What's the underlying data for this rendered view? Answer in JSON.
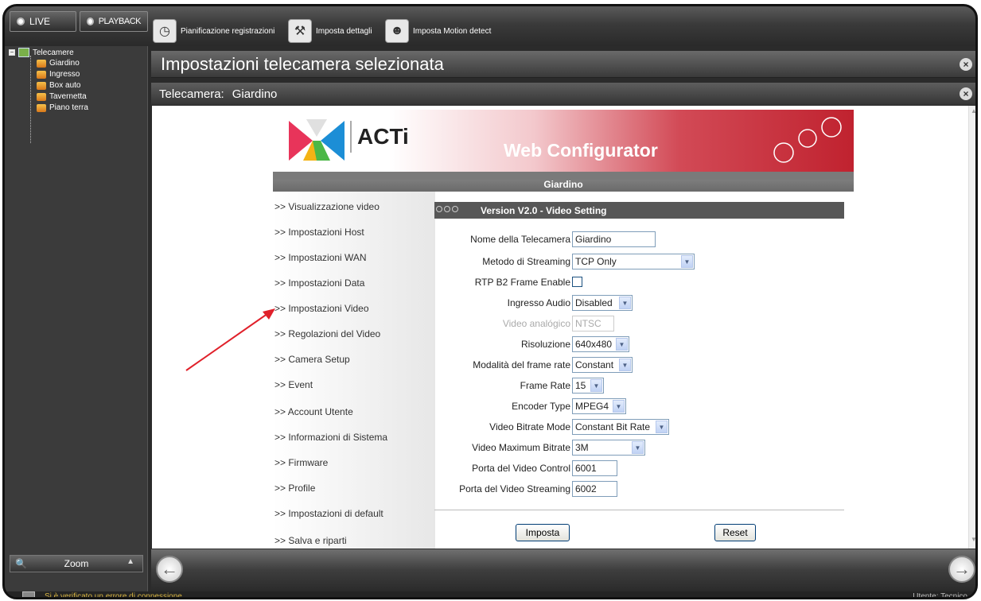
{
  "topbar": {
    "live_label": "LIVE",
    "playback_label": "PLAYBACK",
    "tools": [
      {
        "label": "Pianificazione registrazioni",
        "icon": "clock-icon"
      },
      {
        "label": "Imposta dettagli",
        "icon": "tools-icon"
      },
      {
        "label": "Imposta Motion detect",
        "icon": "motion-icon"
      }
    ]
  },
  "tree": {
    "root": "Telecamere",
    "items": [
      "Giardino",
      "Ingresso",
      "Box auto",
      "Tavernetta",
      "Piano terra"
    ]
  },
  "zoom_label": "Zoom",
  "header": {
    "title": "Impostazioni telecamera selezionata",
    "camera_label": "Telecamera:",
    "camera_name": "Giardino"
  },
  "banner": {
    "logo_text": "ACTi",
    "product": "Web Configurator",
    "camera_strip": "Giardino"
  },
  "menu": [
    ">> Visualizzazione video",
    ">> Impostazioni Host",
    ">> Impostazioni WAN",
    ">> Impostazioni Data",
    ">> Impostazioni Video",
    ">> Regolazioni del Video",
    ">> Camera Setup",
    ">> Event",
    ">> Account Utente",
    ">> Informazioni di Sistema",
    ">> Firmware",
    ">> Profile",
    ">> Impostazioni di default",
    ">> Salva e riparti"
  ],
  "video_setting": {
    "header": "Version V2.0 - Video Setting",
    "fields": {
      "nome": {
        "label": "Nome della Telecamera",
        "value": "Giardino"
      },
      "metodo": {
        "label": "Metodo di Streaming",
        "value": "TCP Only"
      },
      "rtp": {
        "label": "RTP B2 Frame Enable",
        "checked": false
      },
      "audio": {
        "label": "Ingresso Audio",
        "value": "Disabled"
      },
      "analogico": {
        "label": "Video analógico",
        "value": "NTSC"
      },
      "risoluzione": {
        "label": "Risoluzione",
        "value": "640x480"
      },
      "modalita": {
        "label": "Modalità del frame rate",
        "value": "Constant"
      },
      "framerate": {
        "label": "Frame Rate",
        "value": "15"
      },
      "encoder": {
        "label": "Encoder Type",
        "value": "MPEG4"
      },
      "bitrate_mode": {
        "label": "Video Bitrate Mode",
        "value": "Constant Bit Rate"
      },
      "max_bitrate": {
        "label": "Video Maximum Bitrate",
        "value": "3M"
      },
      "porta_control": {
        "label": "Porta del Video Control",
        "value": "6001"
      },
      "porta_streaming": {
        "label": "Porta del Video Streaming",
        "value": "6002"
      }
    },
    "submit_label": "Imposta",
    "reset_label": "Reset"
  },
  "status": {
    "message": "Si è verificato un errore di connessione",
    "user": "Utente: Tecnico"
  },
  "colors": {
    "accent_red": "#c0222f",
    "arrow": "#e0202a",
    "dark_chrome": "#2b2b2b"
  }
}
